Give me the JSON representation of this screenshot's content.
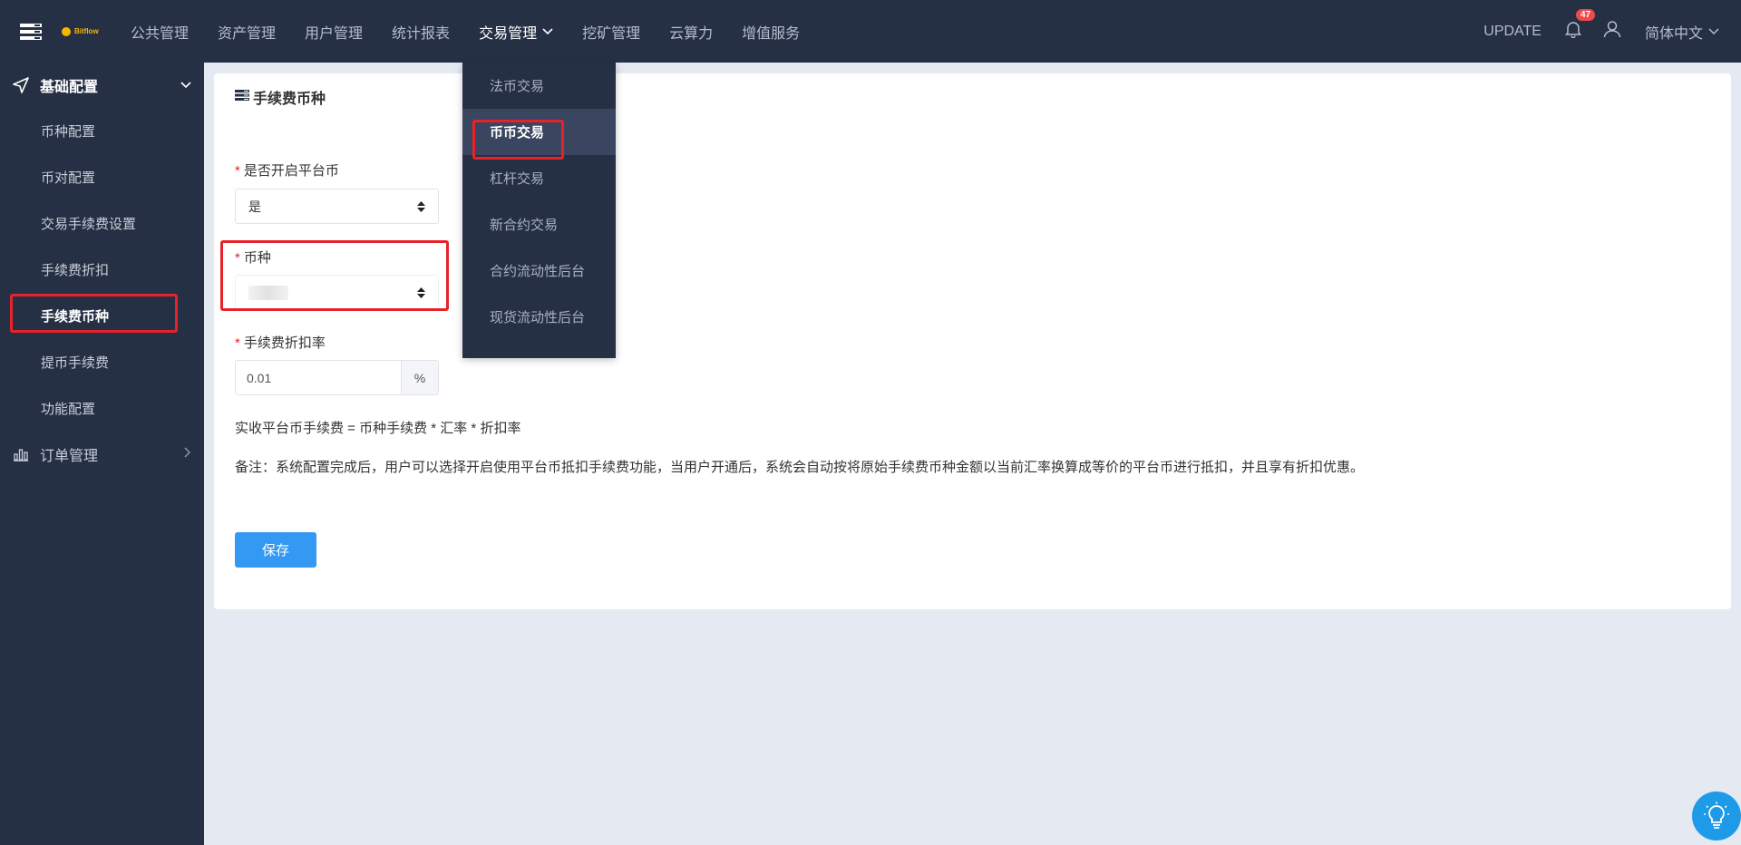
{
  "brand": {
    "name": "Bitflow",
    "logo_icon": "coin-logo-icon"
  },
  "topnav": {
    "items": [
      {
        "label": "公共管理"
      },
      {
        "label": "资产管理"
      },
      {
        "label": "用户管理"
      },
      {
        "label": "统计报表"
      },
      {
        "label": "交易管理",
        "active": true
      },
      {
        "label": "挖矿管理"
      },
      {
        "label": "云算力"
      },
      {
        "label": "增值服务"
      }
    ],
    "update_label": "UPDATE",
    "notification_count": "47",
    "language": "简体中文"
  },
  "dropdown": {
    "items": [
      {
        "label": "法币交易"
      },
      {
        "label": "币币交易",
        "active": true
      },
      {
        "label": "杠杆交易"
      },
      {
        "label": "新合约交易"
      },
      {
        "label": "合约流动性后台"
      },
      {
        "label": "现货流动性后台"
      }
    ]
  },
  "sidebar": {
    "group": {
      "label": "基础配置",
      "icon": "navigation-arrow-icon"
    },
    "items": [
      {
        "label": "币种配置"
      },
      {
        "label": "币对配置"
      },
      {
        "label": "交易手续费设置"
      },
      {
        "label": "手续费折扣"
      },
      {
        "label": "手续费币种",
        "active": true
      },
      {
        "label": "提币手续费"
      },
      {
        "label": "功能配置"
      }
    ],
    "group2": {
      "label": "订单管理",
      "icon": "bar-chart-icon"
    }
  },
  "main": {
    "title": "手续费币种",
    "required_mark": "*",
    "field_enable": {
      "label": "是否开启平台币",
      "value": "是"
    },
    "field_currency": {
      "label": "币种"
    },
    "field_rate": {
      "label": "手续费折扣率",
      "value": "0.01",
      "unit": "%"
    },
    "formula": "实收平台币手续费 = 币种手续费 * 汇率 * 折扣率",
    "note": "备注：系统配置完成后，用户可以选择开启使用平台币抵扣手续费功能，当用户开通后，系统会自动按将原始手续费币种金额以当前汇率换算成等价的平台币进行抵扣，并且享有折扣优惠。",
    "save_label": "保存"
  },
  "colors": {
    "nav_bg": "#263045",
    "page_bg": "#e4e9f2",
    "primary": "#3399f3",
    "highlight": "#e8222a",
    "badge": "#f1494a"
  }
}
